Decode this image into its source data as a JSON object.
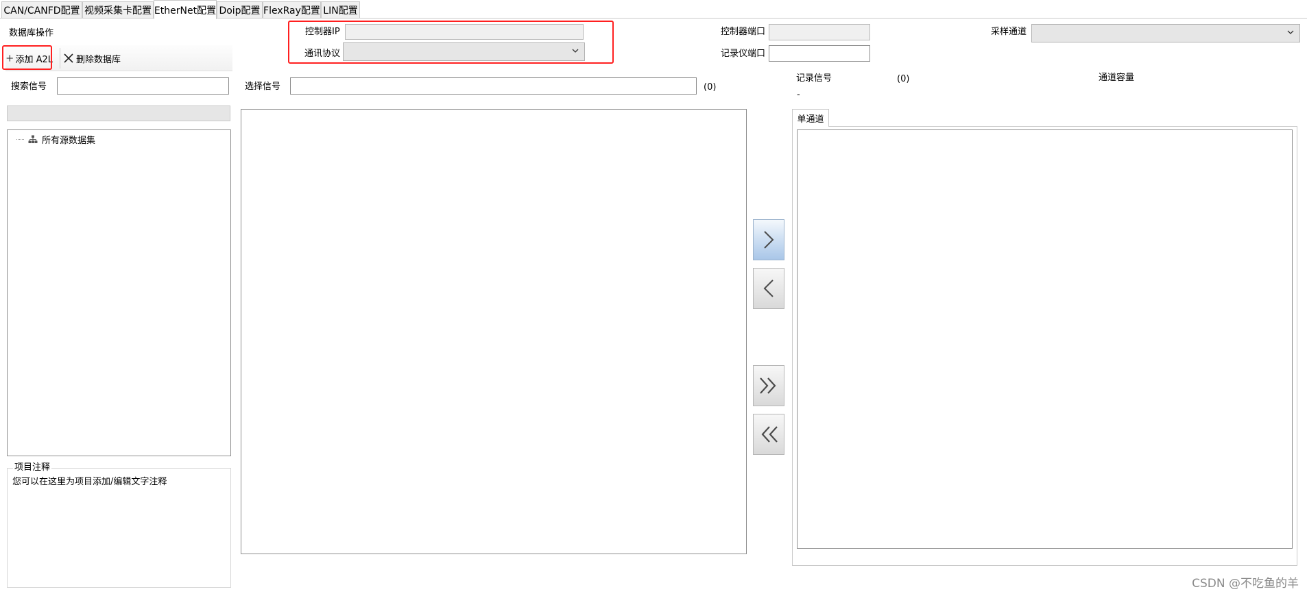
{
  "tabs": [
    {
      "label": "CAN/CANFD配置",
      "active": false
    },
    {
      "label": "视频采集卡配置",
      "active": false
    },
    {
      "label": "EtherNet配置",
      "active": true
    },
    {
      "label": "Doip配置",
      "active": false
    },
    {
      "label": "FlexRay配置",
      "active": false
    },
    {
      "label": "LIN配置",
      "active": false
    }
  ],
  "database": {
    "section_label": "数据库操作",
    "add_button": "添加 A2L",
    "delete_button": "删除数据库"
  },
  "search": {
    "label": "搜索信号",
    "value": ""
  },
  "tree": {
    "root_label": "所有源数据集"
  },
  "notes": {
    "title": "项目注释",
    "text": "您可以在这里为项目添加/编辑文字注释"
  },
  "controller": {
    "ip_label": "控制器IP",
    "ip_value": "",
    "protocol_label": "通讯协议",
    "protocol_value": "",
    "port_label": "控制器端口",
    "port_value": "",
    "recorder_port_label": "记录仪端口",
    "recorder_port_value": "",
    "channel_label": "采样通道",
    "channel_value": ""
  },
  "selection": {
    "label": "选择信号",
    "value": "",
    "count": "(0)"
  },
  "record": {
    "label": "记录信号",
    "count": "(0)",
    "value": "-",
    "capacity_label": "通道容量",
    "subtab": "单通道"
  },
  "transfer_buttons": [
    "add-selected",
    "remove-selected",
    "add-all",
    "remove-all"
  ],
  "colors": {
    "highlight": "#ff1f1f",
    "arrow_active": "#a9c6e8"
  },
  "watermark": "CSDN @不吃鱼的羊"
}
